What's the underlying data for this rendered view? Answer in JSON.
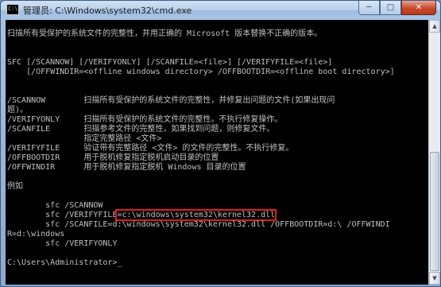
{
  "window": {
    "title": "管理员: C:\\Windows\\system32\\cmd.exe",
    "controls": {
      "minimize": "─",
      "maximize": "□",
      "close": "✕"
    }
  },
  "console": {
    "lines": [
      "扫描所有受保护的系统文件的完整性，并用正确的 Microsoft 版本替换不正确的版本。",
      "",
      "SFC [/SCANNOW] [/VERIFYONLY] [/SCANFILE=<file>] [/VERIFYFILE=<file>]",
      "    [/OFFWINDIR=<offline windows directory> /OFFBOOTDIR=<offline boot directory>]",
      "",
      "",
      "/SCANNOW        扫描所有受保护的系统文件的完整性，并修复出问题的文件(如果出现问",
      "题)。",
      "/VERIFYONLY     扫描所有受保护的系统文件的完整性。不执行修复操作。",
      "/SCANFILE       扫描参考文件的完整性，如果找到问题，则修复文件。",
      "                指定完整路径 <文件>",
      "/VERIFYFILE     验证带有完整路径 <文件> 的文件的完整性。不执行修复。",
      "/OFFBOOTDIR     用于脱机修复指定脱机启动目录的位置",
      "/OFFWINDIR      用于脱机修复指定脱机 Windows 目录的位置",
      "",
      "例如",
      "",
      "        sfc /SCANNOW",
      "",
      "        sfc /SCANFILE=d:\\windows\\system32\\kernel32.dll /OFFBOOTDIR=d:\\ /OFFWINDI",
      "R=d:\\windows",
      "        sfc /VERIFYONLY",
      "",
      "C:\\Users\\Administrator>_"
    ],
    "verifyfile_prefix": "        sfc /VERIFYFILE",
    "verifyfile_highlight": "=c:\\windows\\system32\\kernel32.dll"
  }
}
